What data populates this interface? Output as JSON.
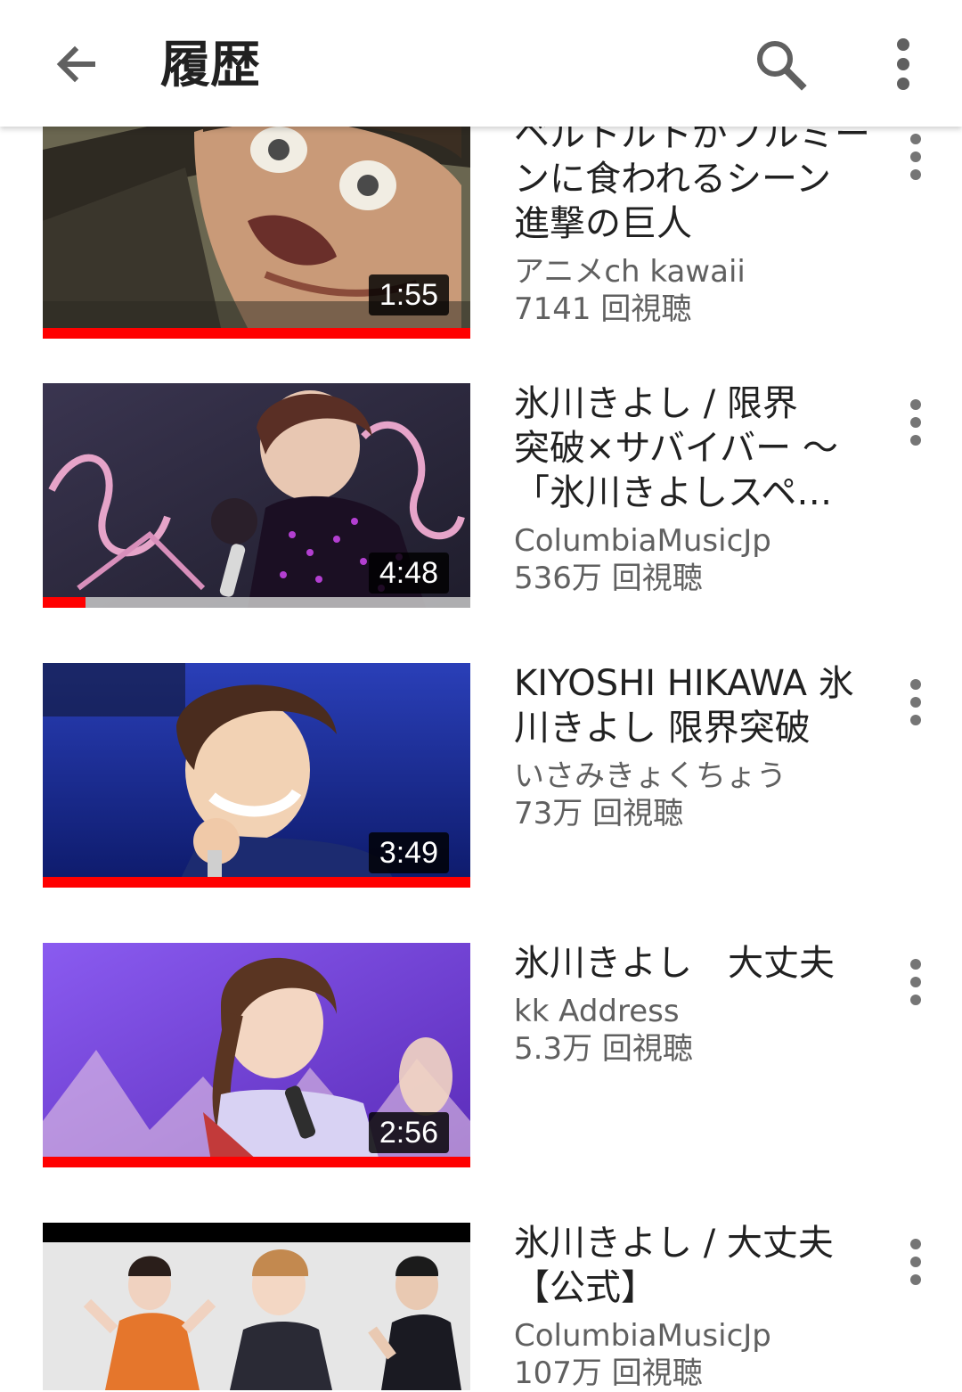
{
  "header": {
    "title": "履歴"
  },
  "videos": [
    {
      "title": "ベルトルトがフルミーンに食われるシーン進撃の巨人",
      "title_lines": [
        "ベルトルトがフルミー",
        "ンに食われるシーン",
        "進撃の巨人"
      ],
      "channel": "アニメch kawaii",
      "views": "7141 回視聴",
      "duration": "1:55",
      "watched": 1.0
    },
    {
      "title_lines": [
        "氷川きよし / 限界",
        "突破×サバイバー ～",
        "「氷川きよしスペ…"
      ],
      "channel": "ColumbiaMusicJp",
      "views": "536万 回視聴",
      "duration": "4:48",
      "watched": 0.1
    },
    {
      "title_lines": [
        "KIYOSHI HIKAWA 氷",
        "川きよし 限界突破"
      ],
      "channel": "いさみきょくちょう",
      "views": "73万 回視聴",
      "duration": "3:49",
      "watched": 1.0
    },
    {
      "title_lines": [
        "氷川きよし　大丈夫"
      ],
      "channel": "kk Address",
      "views": "5.3万 回視聴",
      "duration": "2:56",
      "watched": 1.0
    },
    {
      "title_lines": [
        "氷川きよし / 大丈夫",
        "【公式】"
      ],
      "channel": "ColumbiaMusicJp",
      "views": "107万 回視聴",
      "duration": "",
      "watched": 0
    }
  ],
  "icons": {
    "back": "arrow-back-icon",
    "search": "search-icon",
    "more": "more-vert-icon",
    "item_menu": "more-vert-icon"
  },
  "colors": {
    "progress": "#ff0000",
    "text_primary": "#212121",
    "text_secondary": "#606060"
  }
}
